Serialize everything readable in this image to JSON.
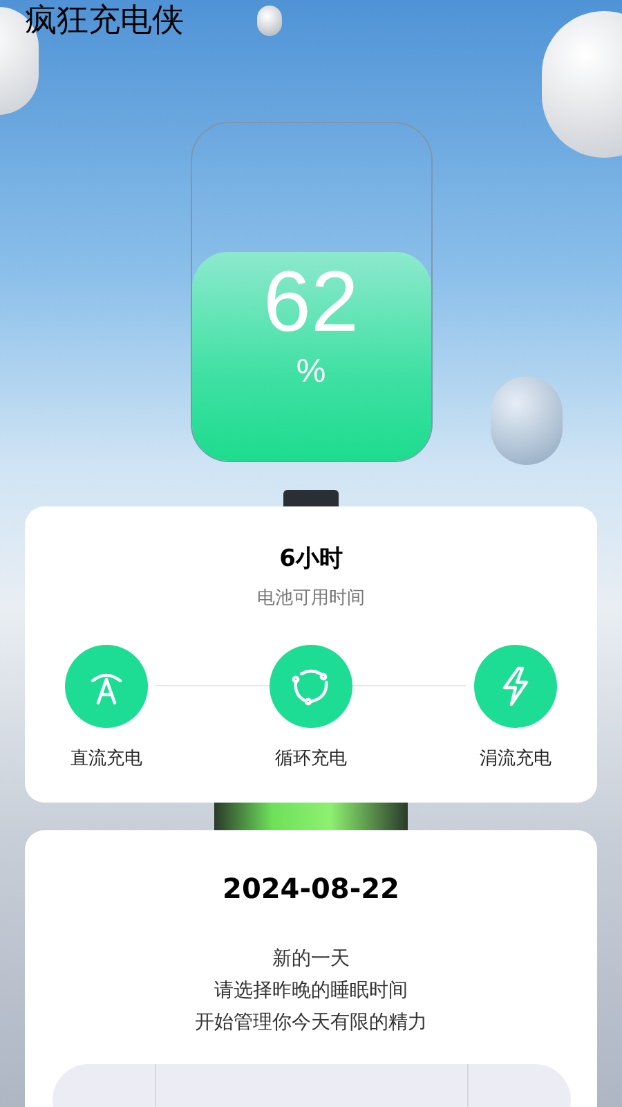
{
  "app_title": "疯狂充电侠",
  "battery": {
    "level": 0.62,
    "percent": "62",
    "unit": "%"
  },
  "usage_card": {
    "duration": "6小时",
    "caption": "电池可用时间",
    "modes": [
      {
        "kind": "dc",
        "label": "直流充电"
      },
      {
        "kind": "cycle",
        "label": "循环充电"
      },
      {
        "kind": "trickle",
        "label": "涓流充电"
      }
    ]
  },
  "sleep_card": {
    "date": "2024-08-22",
    "lines": [
      "新的一天",
      "请选择昨晚的睡眠时间",
      "开始管理你今天有限的精力"
    ]
  }
}
